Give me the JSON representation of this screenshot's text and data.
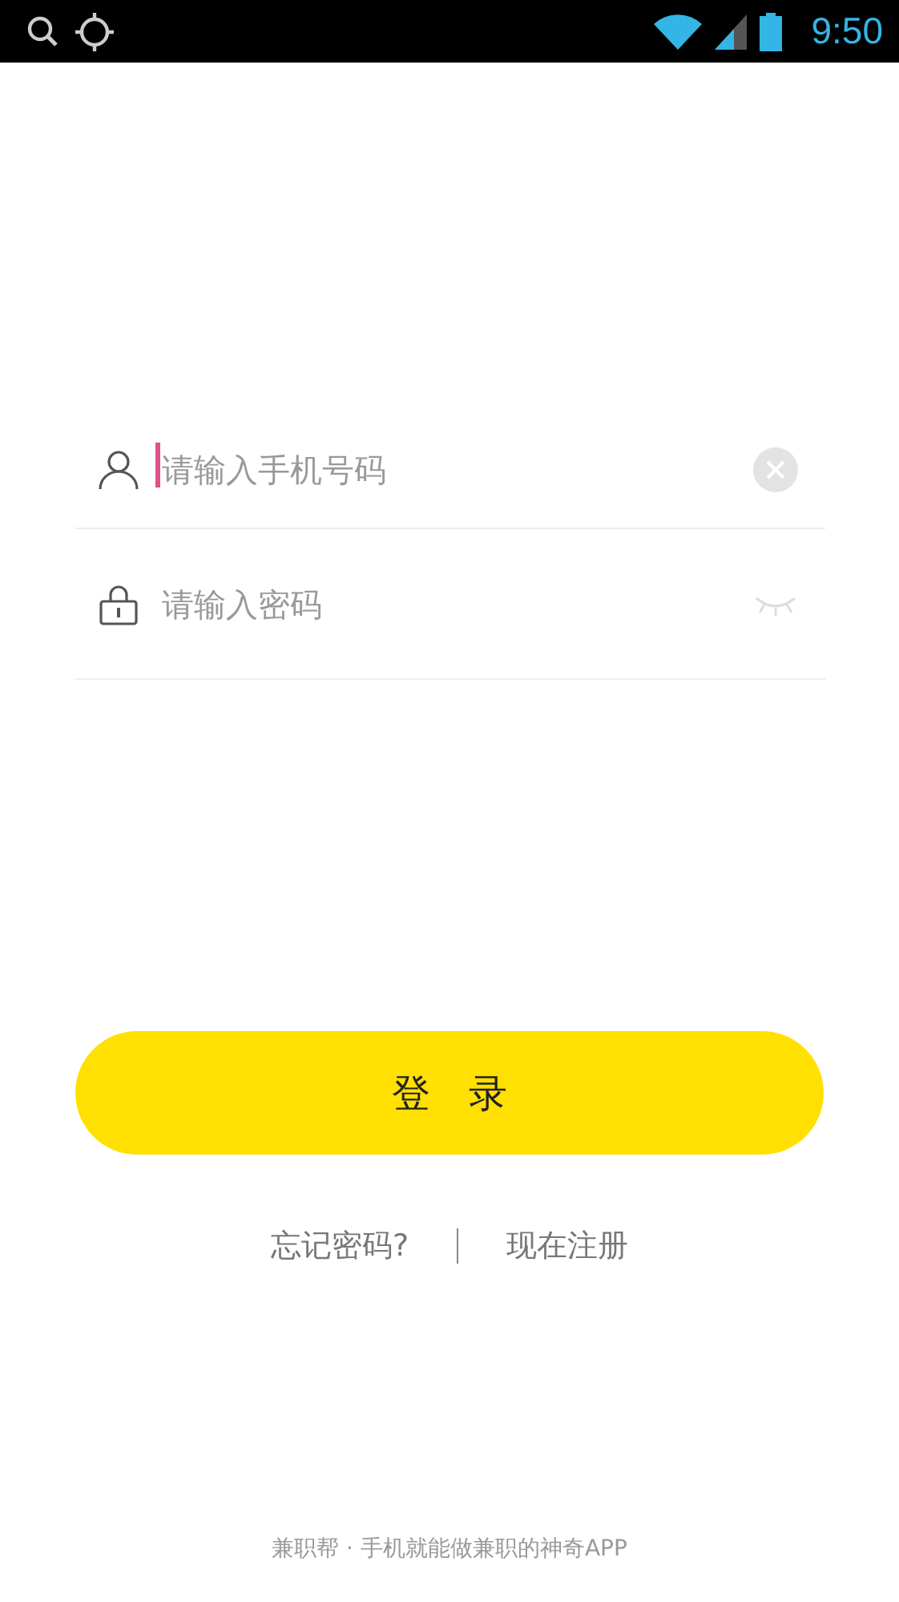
{
  "status_bar": {
    "time": "9:50"
  },
  "phone_field": {
    "placeholder": "请输入手机号码",
    "focused": true
  },
  "password_field": {
    "placeholder": "请输入密码",
    "visible": false
  },
  "login_button": {
    "label": "登　录"
  },
  "links": [
    {
      "label": "忘记密码?"
    },
    {
      "label": "现在注册"
    }
  ],
  "footer": {
    "text": "兼职帮 · 手机就能做兼职的神奇APP"
  }
}
